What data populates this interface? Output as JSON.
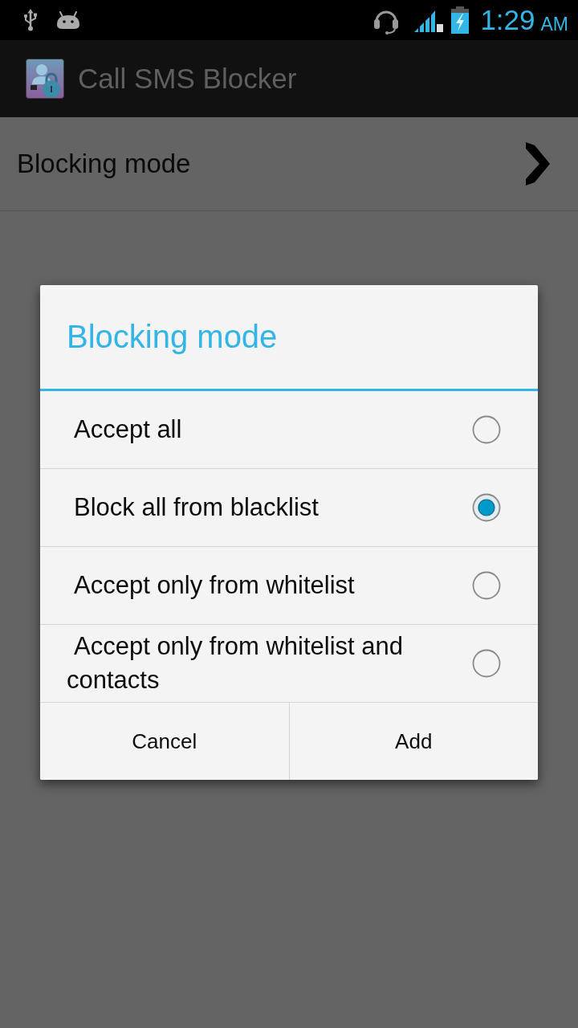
{
  "status_bar": {
    "time": "1:29",
    "meridiem": "AM"
  },
  "action_bar": {
    "title": "Call SMS Blocker"
  },
  "preferences": [
    {
      "title": "Blocking mode"
    }
  ],
  "dialog": {
    "title": "Blocking mode",
    "options": [
      {
        "label": "Accept all",
        "selected": false
      },
      {
        "label": "Block all from blacklist",
        "selected": true
      },
      {
        "label": "Accept only from whitelist",
        "selected": false
      },
      {
        "label": "Accept only from whitelist and contacts",
        "selected": false
      }
    ],
    "buttons": [
      "Cancel",
      "Add"
    ]
  }
}
